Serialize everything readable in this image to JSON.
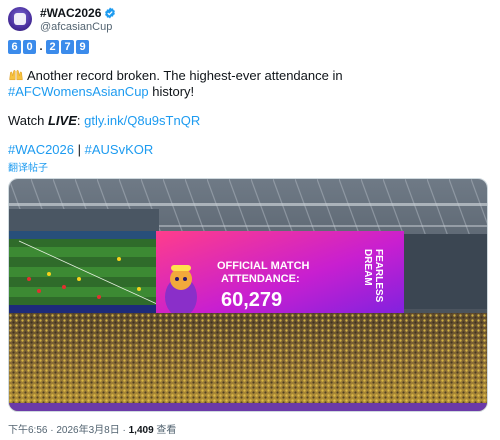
{
  "account": {
    "display_name": "#WAC2026",
    "handle": "@afcasianCup",
    "verified_icon": "verified-badge-icon",
    "accent_color": "#1d9bf0"
  },
  "counter_digits": [
    "6",
    "0",
    ".",
    "2",
    "7",
    "9"
  ],
  "tweet": {
    "line1": "Another record broken. The highest-ever attendance in",
    "line2_hashtag": "#AFCWomensAsianCup",
    "line2_rest": " history!",
    "watch_label": "Watch ",
    "watch_live": "LIVE",
    "watch_colon": ": ",
    "watch_link": "gtly.ink/Q8u9sTnQR",
    "hashtag1": "#WAC2026",
    "hashtag_sep": " | ",
    "hashtag2": "#AUSvKOR",
    "translate_label": "翻译帖子",
    "emoji": "raised-hands-emoji"
  },
  "image": {
    "board_line1": "OFFICIAL MATCH",
    "board_line2": "ATTENDANCE:",
    "board_number": "60,279",
    "board_side1": "DREAM",
    "board_side2": "FEARLESS"
  },
  "meta": {
    "time": "下午6:56",
    "dot": " · ",
    "date": "2026年3月8日",
    "views_count": "1,409",
    "views_label": " 查看"
  }
}
